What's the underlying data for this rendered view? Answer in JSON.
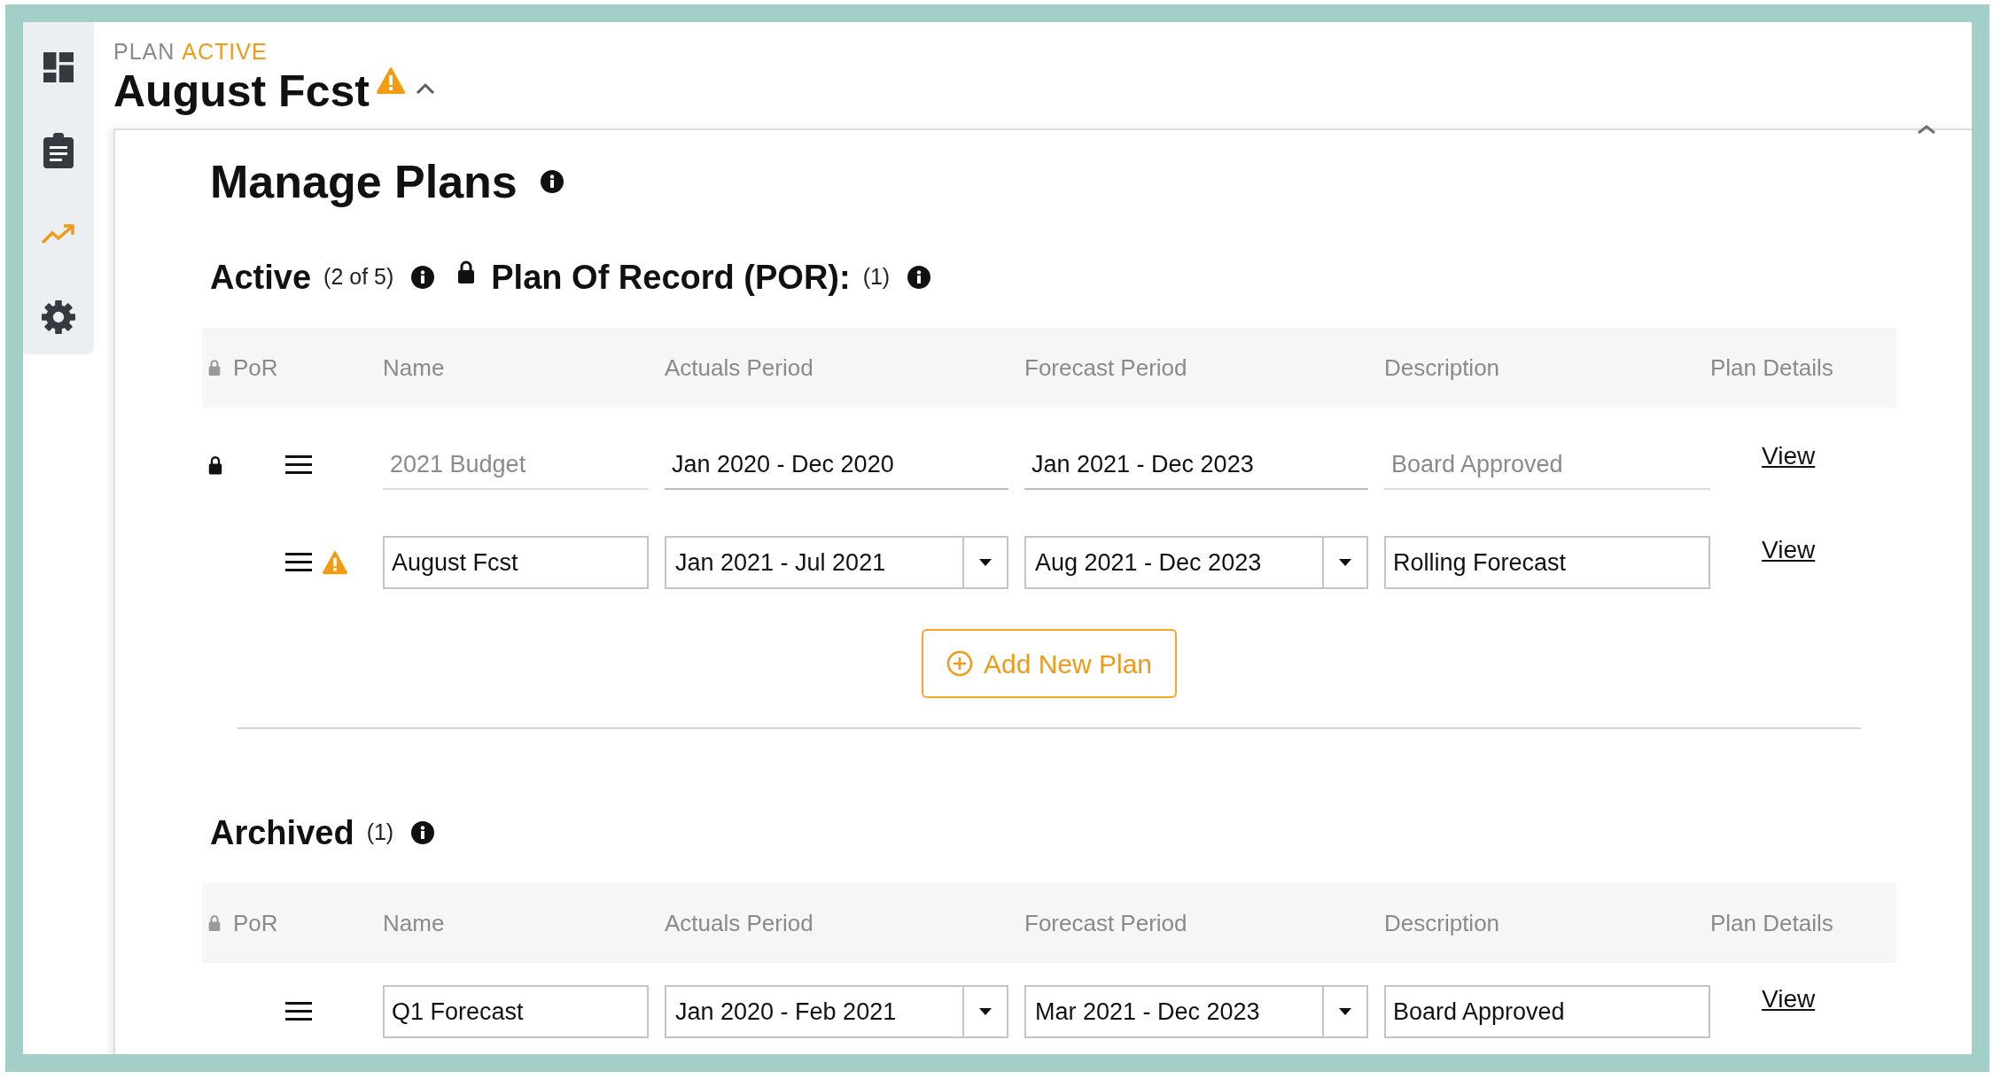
{
  "sidebar": {
    "items": [
      {
        "kind": "dashboard",
        "selected": false
      },
      {
        "kind": "clipboard",
        "selected": false
      },
      {
        "kind": "trend",
        "selected": true
      },
      {
        "kind": "settings",
        "selected": false
      }
    ]
  },
  "header": {
    "eyebrow": "PLAN",
    "status": "ACTIVE",
    "title": "August Fcst",
    "warning": true,
    "expanded": true
  },
  "panel": {
    "title": "Manage Plans",
    "sections": [
      {
        "title": "Active",
        "count": "(2 of 5)",
        "por_label": "Plan Of Record (POR):",
        "por_count": "(1)",
        "columns": [
          "PoR",
          "Name",
          "Actuals Period",
          "Forecast Period",
          "Description",
          "Plan Details"
        ],
        "rows": [
          {
            "locked": true,
            "warning": false,
            "editable": false,
            "name": "2021 Budget",
            "actuals": "Jan 2020 - Dec 2020",
            "forecast": "Jan 2021 - Dec 2023",
            "description": "Board Approved",
            "link": "View"
          },
          {
            "locked": false,
            "warning": true,
            "editable": true,
            "name": "August Fcst",
            "actuals": "Jan 2021 - Jul 2021",
            "forecast": "Aug 2021 - Dec 2023",
            "description": "Rolling Forecast",
            "link": "View"
          }
        ],
        "add_button": "Add New Plan"
      },
      {
        "title": "Archived",
        "count": "(1)",
        "columns": [
          "PoR",
          "Name",
          "Actuals Period",
          "Forecast Period",
          "Description",
          "Plan Details"
        ],
        "rows": [
          {
            "locked": false,
            "warning": false,
            "editable": true,
            "name": "Q1 Forecast",
            "actuals": "Jan 2020 - Feb 2021",
            "forecast": "Mar 2021 - Dec 2023",
            "description": "Board Approved",
            "link": "View"
          }
        ]
      }
    ]
  }
}
